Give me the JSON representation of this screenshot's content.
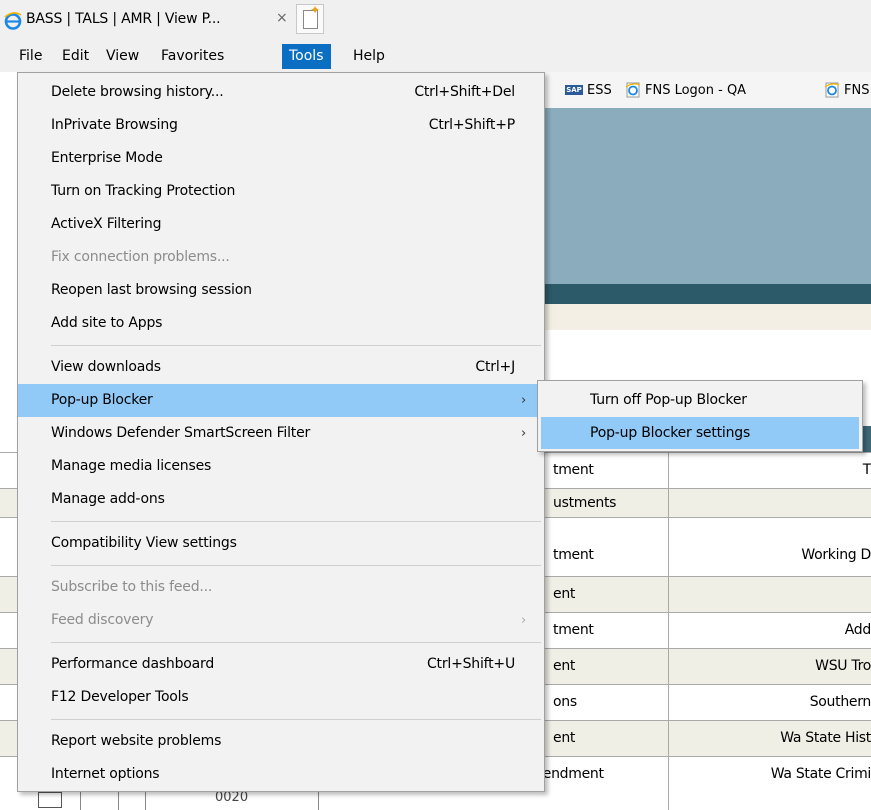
{
  "tab": {
    "title": "BASS | TALS | AMR | View P...",
    "close_glyph": "×",
    "icon": "ie-icon"
  },
  "menubar": {
    "items": [
      "File",
      "Edit",
      "View",
      "Favorites",
      "Tools",
      "Help"
    ],
    "active": "Tools"
  },
  "favorites": {
    "items": [
      {
        "label": "ESS",
        "icon": "sap-icon"
      },
      {
        "label": "FNS Logon - QA",
        "icon": "ie-page-icon"
      },
      {
        "label": "FNS",
        "icon": "ie-page-icon"
      }
    ]
  },
  "tools_menu": {
    "items": [
      {
        "label": "Delete browsing history...",
        "shortcut": "Ctrl+Shift+Del"
      },
      {
        "label": "InPrivate Browsing",
        "shortcut": "Ctrl+Shift+P"
      },
      {
        "label": "Enterprise Mode",
        "shortcut": ""
      },
      {
        "label": "Turn on Tracking Protection",
        "shortcut": ""
      },
      {
        "label": "ActiveX Filtering",
        "shortcut": ""
      },
      {
        "label": "Fix connection problems...",
        "shortcut": "",
        "disabled": true
      },
      {
        "label": "Reopen last browsing session",
        "shortcut": ""
      },
      {
        "label": "Add site to Apps",
        "shortcut": ""
      },
      {
        "label": "View downloads",
        "shortcut": "Ctrl+J"
      },
      {
        "label": "Pop-up Blocker",
        "shortcut": "",
        "submenu": true,
        "highlighted": true
      },
      {
        "label": "Windows Defender SmartScreen Filter",
        "shortcut": "",
        "submenu": true
      },
      {
        "label": "Manage media licenses",
        "shortcut": ""
      },
      {
        "label": "Manage add-ons",
        "shortcut": ""
      },
      {
        "label": "Compatibility View settings",
        "shortcut": ""
      },
      {
        "label": "Subscribe to this feed...",
        "shortcut": "",
        "disabled": true
      },
      {
        "label": "Feed discovery",
        "shortcut": "",
        "disabled": true,
        "submenu": true
      },
      {
        "label": "Performance dashboard",
        "shortcut": "Ctrl+Shift+U"
      },
      {
        "label": "F12 Developer Tools",
        "shortcut": ""
      },
      {
        "label": "Report website problems",
        "shortcut": ""
      },
      {
        "label": "Internet options",
        "shortcut": ""
      }
    ],
    "arrow_glyph": "›"
  },
  "popup_submenu": {
    "items": [
      {
        "label": "Turn off Pop-up Blocker"
      },
      {
        "label": "Pop-up Blocker settings",
        "highlighted": true
      }
    ]
  },
  "table": {
    "rows": [
      {
        "col1": "tment",
        "col2": "T"
      },
      {
        "col1": "ustments",
        "col2": ""
      },
      {
        "col1": "tment",
        "col2": "Working D"
      },
      {
        "col1": "ent",
        "col2": ""
      },
      {
        "col1": "tment",
        "col2": "Add"
      },
      {
        "col1": "ent",
        "col2": "WSU Tro"
      },
      {
        "col1": "ons",
        "col2": "Southern"
      },
      {
        "col1": "ent",
        "col2": "Wa State Hist"
      },
      {
        "col1": "Capital Amendment",
        "col2": "Wa State Crimi"
      }
    ],
    "partial_code": "0020"
  },
  "colors": {
    "menu_active": "#0a6fc2",
    "menu_highlight": "#91c9f7",
    "banner": "#8aacbd",
    "banner_dark": "#2d5a68",
    "row_alt": "#f0efe6"
  }
}
